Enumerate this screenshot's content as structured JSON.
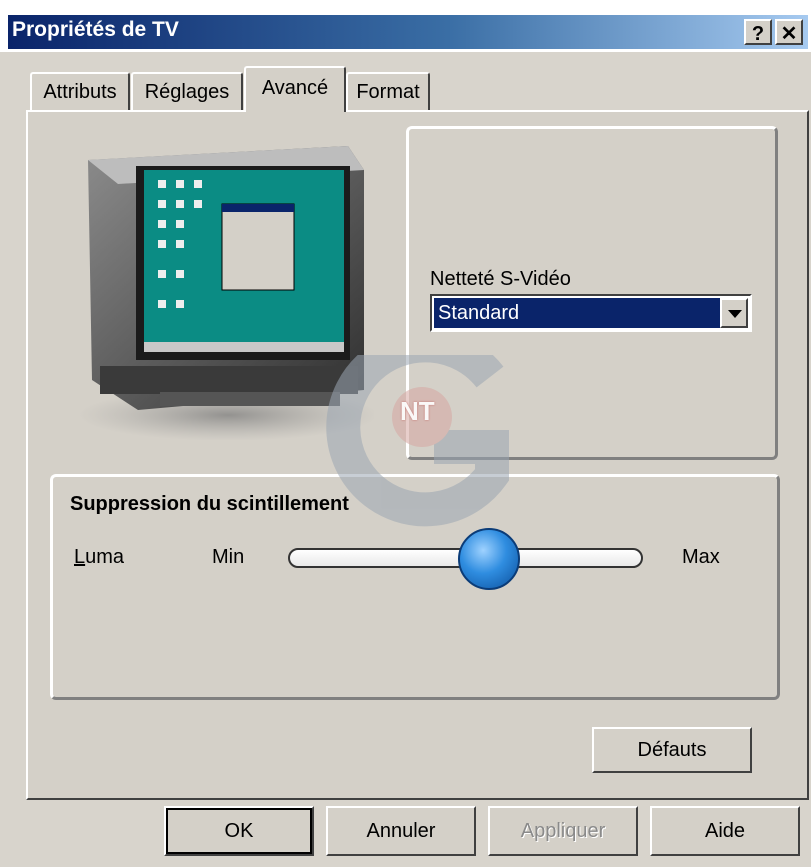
{
  "window": {
    "title": "Propriétés de TV",
    "help_button": "?",
    "close_button": "✕"
  },
  "tabs": [
    {
      "label": "Attributs",
      "active": false
    },
    {
      "label": "Réglages",
      "active": false
    },
    {
      "label": "Avancé",
      "active": true
    },
    {
      "label": "Format",
      "active": false
    }
  ],
  "svideo": {
    "label": "Netteté S-Vidéo",
    "selected": "Standard"
  },
  "flicker": {
    "title": "Suppression du scintillement",
    "channel_label": "Luma",
    "min_label": "Min",
    "max_label": "Max",
    "value_fraction": 0.58
  },
  "buttons": {
    "defaults": "Défauts",
    "ok": "OK",
    "cancel": "Annuler",
    "apply": "Appliquer",
    "help": "Aide"
  },
  "watermark": {
    "letters": "NT",
    "big_letter": "G"
  },
  "colors": {
    "title_bar": "#0a246a",
    "selection": "#0a246a",
    "slider_thumb": "#2f8de0"
  }
}
